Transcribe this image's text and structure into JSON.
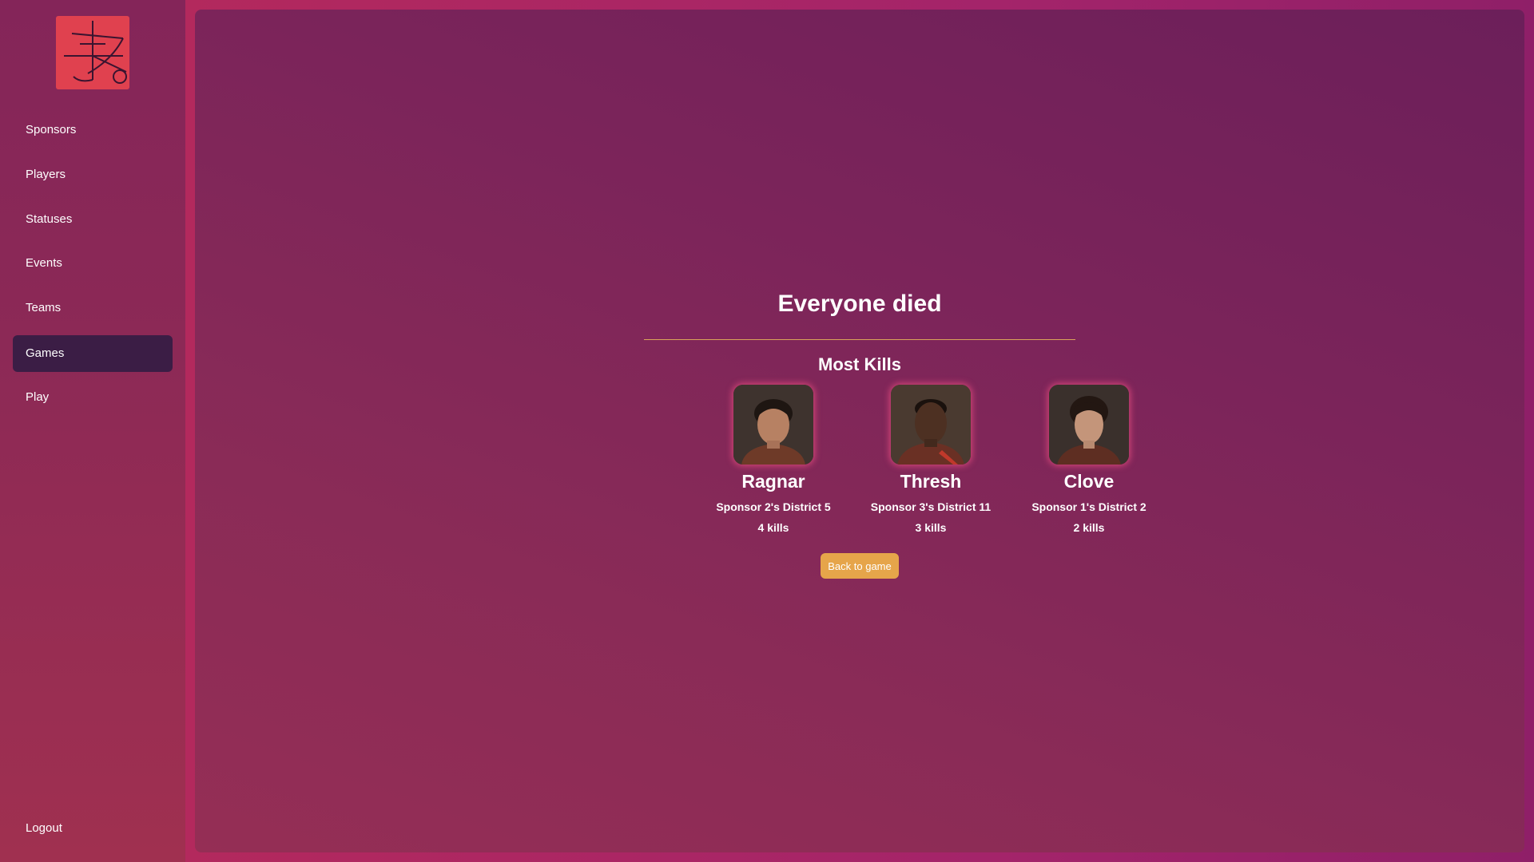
{
  "sidebar": {
    "logo_icon": "sigil-logo-icon",
    "items": [
      {
        "label": "Sponsors",
        "active": false
      },
      {
        "label": "Players",
        "active": false
      },
      {
        "label": "Statuses",
        "active": false
      },
      {
        "label": "Events",
        "active": false
      },
      {
        "label": "Teams",
        "active": false
      },
      {
        "label": "Games",
        "active": true
      },
      {
        "label": "Play",
        "active": false
      }
    ],
    "logout_label": "Logout"
  },
  "main": {
    "title": "Everyone died",
    "section_title": "Most Kills",
    "players": [
      {
        "name": "Ragnar",
        "district": "Sponsor 2's District 5",
        "kills": "4 kills",
        "avatar": "player-portrait"
      },
      {
        "name": "Thresh",
        "district": "Sponsor 3's District 11",
        "kills": "3 kills",
        "avatar": "player-portrait"
      },
      {
        "name": "Clove",
        "district": "Sponsor 1's District 2",
        "kills": "2 kills",
        "avatar": "player-portrait"
      }
    ],
    "back_button_label": "Back to game"
  },
  "colors": {
    "accent": "#e6a54a",
    "active_nav": "#3b1d45",
    "logo_bg": "#e0414f",
    "divider": "#d9a45a"
  }
}
